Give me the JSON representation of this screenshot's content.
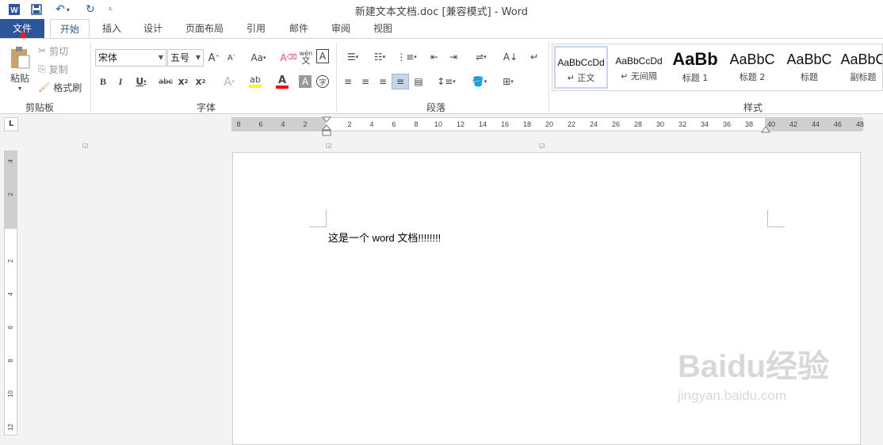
{
  "window": {
    "title": "新建文本文档.doc [兼容模式] - Word"
  },
  "qat": {
    "app_icon": "W",
    "save_icon": "save-icon",
    "undo_icon": "undo-icon",
    "redo_icon": "redo-icon",
    "customize_icon": "customize-icon"
  },
  "tabs": [
    {
      "label": "文件"
    },
    {
      "label": "开始"
    },
    {
      "label": "插入"
    },
    {
      "label": "设计"
    },
    {
      "label": "页面布局"
    },
    {
      "label": "引用"
    },
    {
      "label": "邮件"
    },
    {
      "label": "审阅"
    },
    {
      "label": "视图"
    }
  ],
  "clipboard": {
    "paste": "粘贴",
    "cut": "剪切",
    "copy": "复制",
    "format_painter": "格式刷",
    "group": "剪贴板"
  },
  "font": {
    "name": "宋体",
    "size": "五号",
    "group": "字体"
  },
  "paragraph": {
    "group": "段落"
  },
  "styles": {
    "group": "样式",
    "items": [
      {
        "sample": "AaBbCcDd",
        "name": "↵ 正文"
      },
      {
        "sample": "AaBbCcDd",
        "name": "↵ 无间隔"
      },
      {
        "sample": "AaBb",
        "name": "标题 1"
      },
      {
        "sample": "AaBbC",
        "name": "标题 2"
      },
      {
        "sample": "AaBbC",
        "name": "标题"
      },
      {
        "sample": "AaBbC",
        "name": "副标题"
      }
    ]
  },
  "ruler": {
    "tab_selector": "L",
    "h_ticks": [
      "8",
      "6",
      "4",
      "2",
      "2",
      "4",
      "6",
      "8",
      "10",
      "12",
      "14",
      "16",
      "18",
      "20",
      "22",
      "24",
      "26",
      "28",
      "30",
      "32",
      "34",
      "36",
      "38",
      "40",
      "42",
      "44",
      "46",
      "48"
    ],
    "v_ticks": [
      "4",
      "2",
      "2",
      "4",
      "6",
      "8",
      "10",
      "12"
    ]
  },
  "document": {
    "text": "这是一个 word 文档!!!!!!!!"
  },
  "watermark": {
    "text": "Baidu经验",
    "sub": "jingyan.baidu.com"
  },
  "colors": {
    "accent": "#2b579a",
    "highlight": "#ffff00",
    "font_color": "#ff0000"
  }
}
